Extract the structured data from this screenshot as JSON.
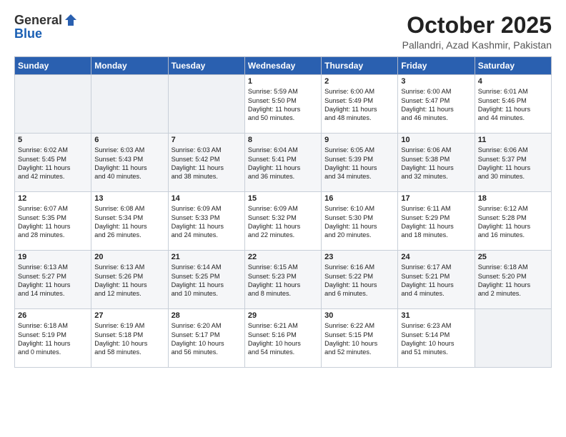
{
  "header": {
    "logo_line1": "General",
    "logo_line2": "Blue",
    "month": "October 2025",
    "location": "Pallandri, Azad Kashmir, Pakistan"
  },
  "days_of_week": [
    "Sunday",
    "Monday",
    "Tuesday",
    "Wednesday",
    "Thursday",
    "Friday",
    "Saturday"
  ],
  "weeks": [
    [
      {
        "day": "",
        "text": ""
      },
      {
        "day": "",
        "text": ""
      },
      {
        "day": "",
        "text": ""
      },
      {
        "day": "1",
        "text": "Sunrise: 5:59 AM\nSunset: 5:50 PM\nDaylight: 11 hours\nand 50 minutes."
      },
      {
        "day": "2",
        "text": "Sunrise: 6:00 AM\nSunset: 5:49 PM\nDaylight: 11 hours\nand 48 minutes."
      },
      {
        "day": "3",
        "text": "Sunrise: 6:00 AM\nSunset: 5:47 PM\nDaylight: 11 hours\nand 46 minutes."
      },
      {
        "day": "4",
        "text": "Sunrise: 6:01 AM\nSunset: 5:46 PM\nDaylight: 11 hours\nand 44 minutes."
      }
    ],
    [
      {
        "day": "5",
        "text": "Sunrise: 6:02 AM\nSunset: 5:45 PM\nDaylight: 11 hours\nand 42 minutes."
      },
      {
        "day": "6",
        "text": "Sunrise: 6:03 AM\nSunset: 5:43 PM\nDaylight: 11 hours\nand 40 minutes."
      },
      {
        "day": "7",
        "text": "Sunrise: 6:03 AM\nSunset: 5:42 PM\nDaylight: 11 hours\nand 38 minutes."
      },
      {
        "day": "8",
        "text": "Sunrise: 6:04 AM\nSunset: 5:41 PM\nDaylight: 11 hours\nand 36 minutes."
      },
      {
        "day": "9",
        "text": "Sunrise: 6:05 AM\nSunset: 5:39 PM\nDaylight: 11 hours\nand 34 minutes."
      },
      {
        "day": "10",
        "text": "Sunrise: 6:06 AM\nSunset: 5:38 PM\nDaylight: 11 hours\nand 32 minutes."
      },
      {
        "day": "11",
        "text": "Sunrise: 6:06 AM\nSunset: 5:37 PM\nDaylight: 11 hours\nand 30 minutes."
      }
    ],
    [
      {
        "day": "12",
        "text": "Sunrise: 6:07 AM\nSunset: 5:35 PM\nDaylight: 11 hours\nand 28 minutes."
      },
      {
        "day": "13",
        "text": "Sunrise: 6:08 AM\nSunset: 5:34 PM\nDaylight: 11 hours\nand 26 minutes."
      },
      {
        "day": "14",
        "text": "Sunrise: 6:09 AM\nSunset: 5:33 PM\nDaylight: 11 hours\nand 24 minutes."
      },
      {
        "day": "15",
        "text": "Sunrise: 6:09 AM\nSunset: 5:32 PM\nDaylight: 11 hours\nand 22 minutes."
      },
      {
        "day": "16",
        "text": "Sunrise: 6:10 AM\nSunset: 5:30 PM\nDaylight: 11 hours\nand 20 minutes."
      },
      {
        "day": "17",
        "text": "Sunrise: 6:11 AM\nSunset: 5:29 PM\nDaylight: 11 hours\nand 18 minutes."
      },
      {
        "day": "18",
        "text": "Sunrise: 6:12 AM\nSunset: 5:28 PM\nDaylight: 11 hours\nand 16 minutes."
      }
    ],
    [
      {
        "day": "19",
        "text": "Sunrise: 6:13 AM\nSunset: 5:27 PM\nDaylight: 11 hours\nand 14 minutes."
      },
      {
        "day": "20",
        "text": "Sunrise: 6:13 AM\nSunset: 5:26 PM\nDaylight: 11 hours\nand 12 minutes."
      },
      {
        "day": "21",
        "text": "Sunrise: 6:14 AM\nSunset: 5:25 PM\nDaylight: 11 hours\nand 10 minutes."
      },
      {
        "day": "22",
        "text": "Sunrise: 6:15 AM\nSunset: 5:23 PM\nDaylight: 11 hours\nand 8 minutes."
      },
      {
        "day": "23",
        "text": "Sunrise: 6:16 AM\nSunset: 5:22 PM\nDaylight: 11 hours\nand 6 minutes."
      },
      {
        "day": "24",
        "text": "Sunrise: 6:17 AM\nSunset: 5:21 PM\nDaylight: 11 hours\nand 4 minutes."
      },
      {
        "day": "25",
        "text": "Sunrise: 6:18 AM\nSunset: 5:20 PM\nDaylight: 11 hours\nand 2 minutes."
      }
    ],
    [
      {
        "day": "26",
        "text": "Sunrise: 6:18 AM\nSunset: 5:19 PM\nDaylight: 11 hours\nand 0 minutes."
      },
      {
        "day": "27",
        "text": "Sunrise: 6:19 AM\nSunset: 5:18 PM\nDaylight: 10 hours\nand 58 minutes."
      },
      {
        "day": "28",
        "text": "Sunrise: 6:20 AM\nSunset: 5:17 PM\nDaylight: 10 hours\nand 56 minutes."
      },
      {
        "day": "29",
        "text": "Sunrise: 6:21 AM\nSunset: 5:16 PM\nDaylight: 10 hours\nand 54 minutes."
      },
      {
        "day": "30",
        "text": "Sunrise: 6:22 AM\nSunset: 5:15 PM\nDaylight: 10 hours\nand 52 minutes."
      },
      {
        "day": "31",
        "text": "Sunrise: 6:23 AM\nSunset: 5:14 PM\nDaylight: 10 hours\nand 51 minutes."
      },
      {
        "day": "",
        "text": ""
      }
    ]
  ]
}
